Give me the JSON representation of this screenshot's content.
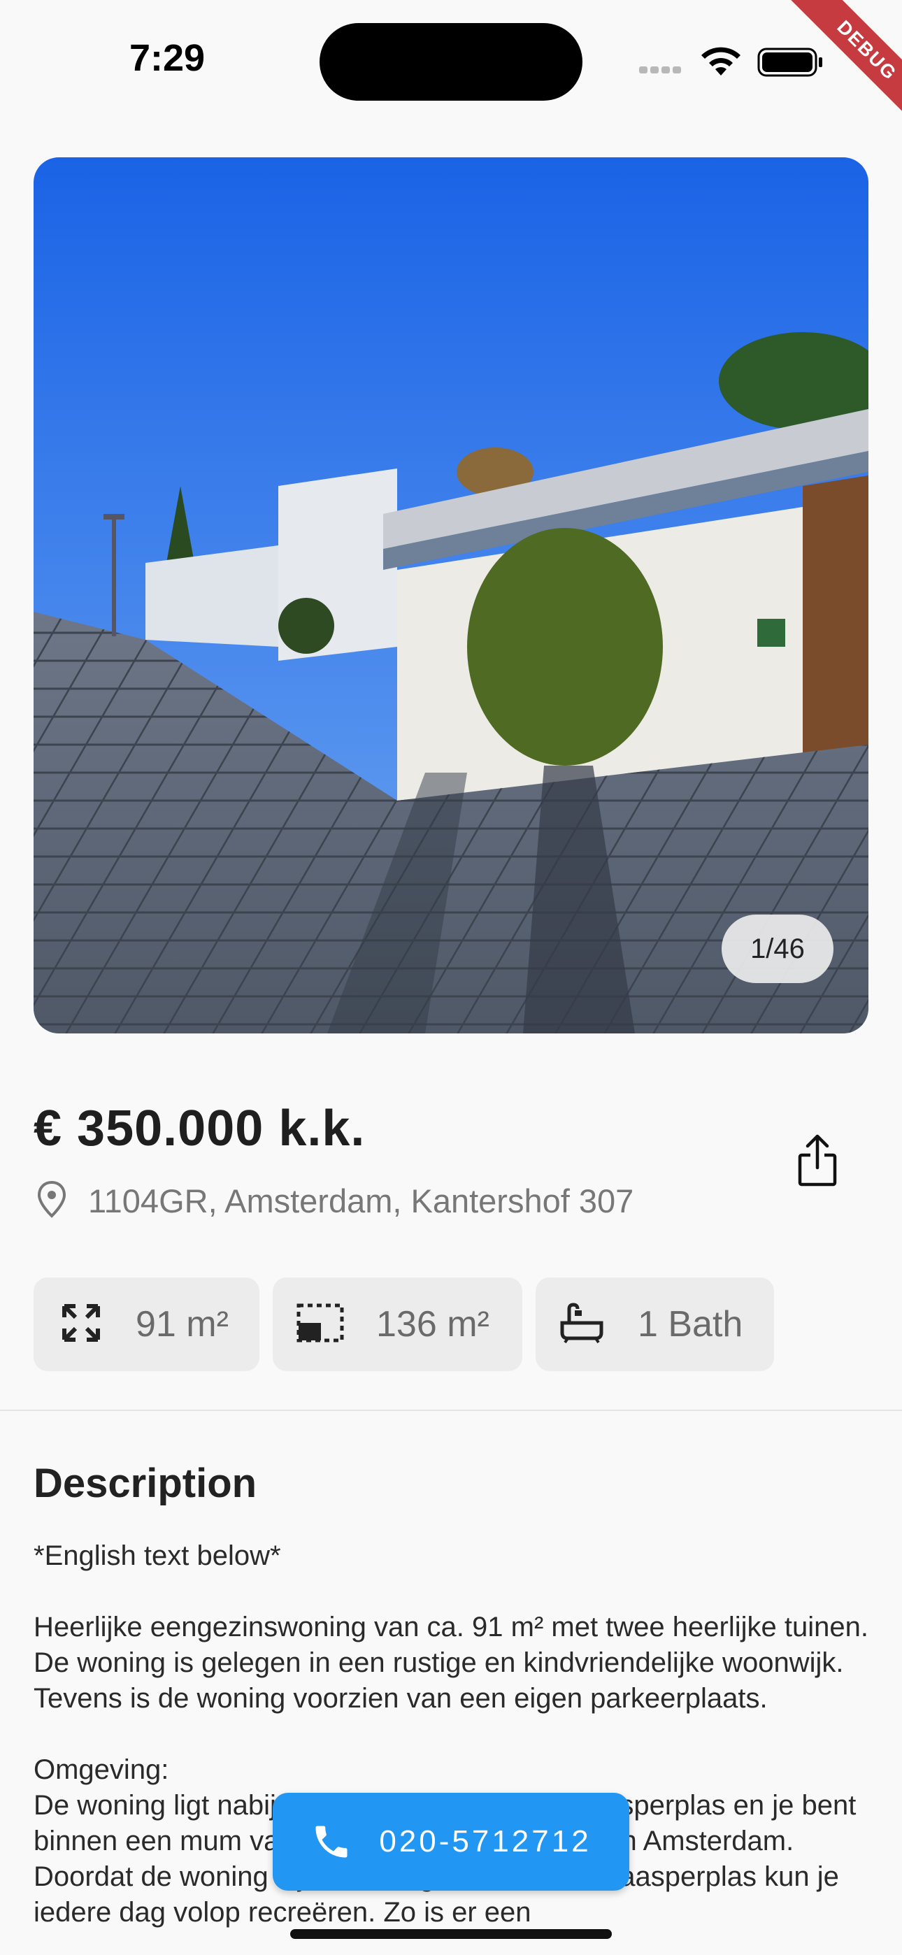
{
  "status_bar": {
    "time": "7:29",
    "debug_banner": "DEBUG"
  },
  "gallery": {
    "counter": "1/46"
  },
  "listing": {
    "price": "€ 350.000 k.k.",
    "address": "1104GR, Amsterdam, Kantershof 307",
    "features": [
      {
        "icon": "expand-icon",
        "label": "91 m²"
      },
      {
        "icon": "plot-area-icon",
        "label": "136 m²"
      },
      {
        "icon": "bathtub-icon",
        "label": "1 Bath"
      }
    ]
  },
  "description": {
    "title": "Description",
    "body": "*English text below*\n\nHeerlijke eengezinswoning van ca. 91 m² met twee heerlijke tuinen. De woning is gelegen in een rustige en kindvriendelijke woonwijk. Tevens is de woning voorzien van een eigen parkeerplaats.\n\nOmgeving:\nDe woning ligt nabij de Gaasperplas en de Gaasperplas en je bent binnen een mum van tijd in het centrum stad van Amsterdam. Doordat de woning bijna direct grenst aan de Gaasperplas kun je iedere dag volop recreëren. Zo is er een"
  },
  "call_button": {
    "label": "020-5712712"
  },
  "colors": {
    "accent": "#2196f3",
    "debug": "#c53b3f"
  }
}
